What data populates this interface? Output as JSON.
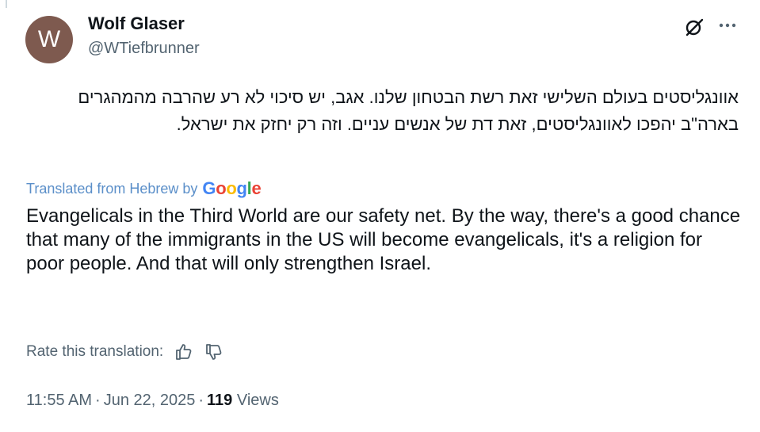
{
  "author": {
    "avatar_letter": "W",
    "display_name": "Wolf Glaser",
    "handle": "@WTiefbrunner"
  },
  "tweet": {
    "original_text": "אוונגליסטים בעולם השלישי זאת רשת הבטחון שלנו. אגב, יש סיכוי לא רע שהרבה מהמהגרים בארה\"ב יהפכו לאוונגליסטים, זאת דת של אנשים עניים. וזה רק יחזק את ישראל.",
    "translation_notice": "Translated from Hebrew by",
    "translation_provider": "Google",
    "translated_text": "Evangelicals in the Third World are our safety net. By the way, there's a good chance that many of the immigrants in the US will become evangelicals, it's a religion for poor people. And that will only strengthen Israel.",
    "rate_label": "Rate this translation:",
    "time": "11:55 AM",
    "date": "Jun 22, 2025",
    "views_count": "119",
    "views_label": "Views",
    "separator": "·"
  },
  "icons": {
    "grok": "grok-icon",
    "more": "more-icon",
    "thumbs_up": "thumbs-up-icon",
    "thumbs_down": "thumbs-down-icon"
  },
  "colors": {
    "text": "#0f1419",
    "secondary": "#536471",
    "translated_link": "#5b8fc9",
    "avatar_bg": "#7e5a4f"
  }
}
